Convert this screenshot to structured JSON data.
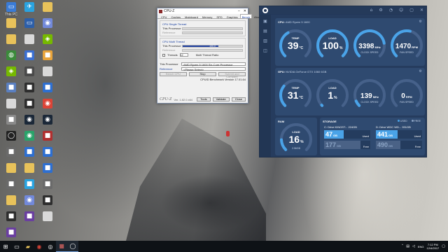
{
  "desktop": {
    "icons": [
      {
        "label": "This PC",
        "icon": "computer-icon",
        "color": "#3a7bd5",
        "glyph": "▭"
      },
      {
        "label": "",
        "icon": "telegram-icon",
        "color": "#2aa3e0",
        "glyph": "✈"
      },
      {
        "label": "",
        "icon": "folder-icon",
        "color": "#e8c25a",
        "glyph": ""
      },
      {
        "label": "",
        "icon": "folder-icon",
        "color": "#e8c25a",
        "glyph": ""
      },
      {
        "label": "",
        "icon": "monitor-icon",
        "color": "#2d5fa8",
        "glyph": "▭"
      },
      {
        "label": "",
        "icon": "discord-icon",
        "color": "#7289da",
        "glyph": "◉"
      },
      {
        "label": "",
        "icon": "folder-icon",
        "color": "#e8c25a",
        "glyph": ""
      },
      {
        "label": "",
        "icon": "file-icon",
        "color": "#d9d9d9",
        "glyph": ""
      },
      {
        "label": "",
        "icon": "nvidia-icon",
        "color": "#76b900",
        "glyph": "◈"
      },
      {
        "label": "",
        "icon": "earth-icon",
        "color": "#3b8a3b",
        "glyph": "◍"
      },
      {
        "label": "",
        "icon": "app-icon",
        "color": "#3b6fd0",
        "glyph": "■"
      },
      {
        "label": "",
        "icon": "app-icon",
        "color": "#e8a33a",
        "glyph": "■"
      },
      {
        "label": "",
        "icon": "geforce-icon",
        "color": "#76b900",
        "glyph": "◈"
      },
      {
        "label": "",
        "icon": "app-icon",
        "color": "#4a4a4a",
        "glyph": "■"
      },
      {
        "label": "",
        "icon": "file-icon",
        "color": "#d9d9d9",
        "glyph": ""
      },
      {
        "label": "",
        "icon": "app-icon",
        "color": "#5a7fc0",
        "glyph": "■"
      },
      {
        "label": "",
        "icon": "app-icon",
        "color": "#2e2e2e",
        "glyph": "■"
      },
      {
        "label": "",
        "icon": "app-icon",
        "color": "#2e6fd0",
        "glyph": "■"
      },
      {
        "label": "",
        "icon": "file-icon",
        "color": "#d9d9d9",
        "glyph": ""
      },
      {
        "label": "",
        "icon": "app-icon",
        "color": "#2e2e2e",
        "glyph": "■"
      },
      {
        "label": "",
        "icon": "chrome-icon",
        "color": "#db4437",
        "glyph": "◉"
      },
      {
        "label": "",
        "icon": "app-icon",
        "color": "#8a8a8a",
        "glyph": "■"
      },
      {
        "label": "",
        "icon": "steam-icon",
        "color": "#1b2838",
        "glyph": "◉"
      },
      {
        "label": "",
        "icon": "steam-icon",
        "color": "#1b2838",
        "glyph": "◉"
      },
      {
        "label": "",
        "icon": "nzxt-icon",
        "color": "#222",
        "glyph": "◯"
      },
      {
        "label": "",
        "icon": "app-icon",
        "color": "#2aa36a",
        "glyph": "◉"
      },
      {
        "label": "",
        "icon": "app-icon",
        "color": "#b03030",
        "glyph": "■"
      },
      {
        "label": "",
        "icon": "app-icon",
        "color": "#6a6a6a",
        "glyph": "■"
      },
      {
        "label": "",
        "icon": "app-icon",
        "color": "#2e6fd0",
        "glyph": "■"
      },
      {
        "label": "",
        "icon": "app-icon",
        "color": "#2e6fd0",
        "glyph": "■"
      },
      {
        "label": "",
        "icon": "folder-icon",
        "color": "#e8c25a",
        "glyph": ""
      },
      {
        "label": "",
        "icon": "folder-icon",
        "color": "#e8c25a",
        "glyph": ""
      },
      {
        "label": "",
        "icon": "app-icon",
        "color": "#2e6fd0",
        "glyph": "■"
      },
      {
        "label": "",
        "icon": "app-icon",
        "color": "#6a6a6a",
        "glyph": "■"
      },
      {
        "label": "",
        "icon": "app-icon",
        "color": "#2aa3e0",
        "glyph": "■"
      },
      {
        "label": "",
        "icon": "app-icon",
        "color": "#6a6a6a",
        "glyph": "■"
      },
      {
        "label": "",
        "icon": "folder-icon",
        "color": "#e8c25a",
        "glyph": ""
      },
      {
        "label": "",
        "icon": "discord-icon",
        "color": "#7289da",
        "glyph": "◉"
      },
      {
        "label": "",
        "icon": "app-icon",
        "color": "#2e2e2e",
        "glyph": "■"
      },
      {
        "label": "",
        "icon": "app-icon",
        "color": "#2e2e2e",
        "glyph": "■"
      },
      {
        "label": "",
        "icon": "app-icon",
        "color": "#6a3fa0",
        "glyph": "■"
      },
      {
        "label": "",
        "icon": "file-icon",
        "color": "#d9d9d9",
        "glyph": ""
      },
      {
        "label": "",
        "icon": "app-icon",
        "color": "#6a3fa0",
        "glyph": "■"
      }
    ]
  },
  "cpuz": {
    "title": "CPU-Z",
    "tabs": [
      "CPU",
      "Caches",
      "Mainboard",
      "Memory",
      "SPD",
      "Graphics",
      "Bench",
      "About"
    ],
    "active_tab": "Bench",
    "single_thread": {
      "title": "CPU Single Thread",
      "this_processor": "This Processor",
      "reference": "Reference"
    },
    "multi_thread": {
      "title": "CPU Multi Thread",
      "this_processor": "This Processor",
      "reference": "Reference",
      "progress": 0.6,
      "progress_text": "100.0"
    },
    "threads_label": "Threads",
    "threads_value": "12",
    "ratio_label": "Multi Thread Ratio",
    "this_processor_label": "This Processor",
    "this_processor_value": "AMD Ryzen 5 1600 Six-Core Processor",
    "reference_label": "Reference",
    "reference_value": "<Please Select>",
    "buttons": {
      "bench_cpu": "Bench CPU",
      "stop": "Stop",
      "submit": "Submit and Compare"
    },
    "version_text": "CPUID Benchmark Version 17.01.64",
    "brand": "CPU-Z",
    "ver": "Ver. 1.82.0.x64",
    "tools": "Tools",
    "validate": "Validate",
    "close": "Close"
  },
  "cam": {
    "cpu": {
      "title": "CPU:",
      "name": "AMD Ryzen 5 1600",
      "temp": {
        "label": "TEMP",
        "value": "39",
        "unit": "°C",
        "level": 0.39
      },
      "load": {
        "label": "LOAD",
        "value": "100",
        "unit": "%",
        "level": 1.0
      },
      "clock": {
        "label": "CLOCK SPEED",
        "value": "3398",
        "unit": "MHz",
        "level": 0.8
      },
      "fan": {
        "label": "FAN SPEED",
        "value": "1470",
        "unit": "RPM",
        "level": 0.55
      }
    },
    "gpu": {
      "title": "GPU:",
      "name": "NVIDIA GeForce GTX 1060 6GB",
      "temp": {
        "label": "TEMP",
        "value": "31",
        "unit": "°C",
        "level": 0.31
      },
      "load": {
        "label": "LOAD",
        "value": "1",
        "unit": "%",
        "level": 0.01
      },
      "clock": {
        "label": "CLOCK SPEED",
        "value": "139",
        "unit": "MHz",
        "level": 0.08
      },
      "fan": {
        "label": "FAN SPEED",
        "value": "0",
        "unit": "RPM",
        "level": 0.0
      }
    },
    "ram": {
      "title": "RAM",
      "load": {
        "label": "LOAD",
        "value": "16",
        "unit": "%",
        "sub": "2.56GB",
        "level": 0.16
      }
    },
    "storage": {
      "title": "STORAGE",
      "legend_used": "USED",
      "legend_free": "FREE",
      "drives": [
        {
          "name": "C: Drive KINGST... 224GB",
          "used": "47",
          "used_unit": "GB",
          "used_label": "Used",
          "free": "177",
          "free_unit": "GB",
          "free_label": "Free",
          "used_fraction": 0.21
        },
        {
          "name": "D: Drive WDC WD... 931GB",
          "used": "441",
          "used_unit": "GB",
          "used_label": "Used",
          "free": "490",
          "free_unit": "GB",
          "free_label": "Free",
          "used_fraction": 0.47
        }
      ]
    },
    "colors": {
      "accent": "#4aa3e8",
      "track": "#46618a",
      "used": "#4aa3e8",
      "free": "#8aa3c4"
    }
  },
  "taskbar": {
    "time": "7:12 PM",
    "date": "12/4/2017",
    "lang": "ENG"
  }
}
